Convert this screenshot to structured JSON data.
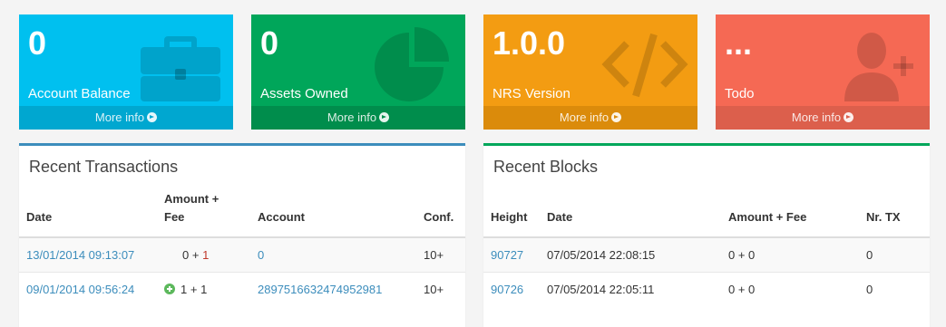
{
  "tiles": [
    {
      "value": "0",
      "label": "Account Balance",
      "footer": "More info",
      "icon": "briefcase-icon"
    },
    {
      "value": "0",
      "label": "Assets Owned",
      "footer": "More info",
      "icon": "pie-chart-icon"
    },
    {
      "value": "1.0.0",
      "label": "NRS Version",
      "footer": "More info",
      "icon": "code-icon"
    },
    {
      "value": "...",
      "label": "Todo",
      "footer": "More info",
      "icon": "user-plus-icon"
    }
  ],
  "transactions": {
    "title": "Recent Transactions",
    "columns": {
      "date": "Date",
      "amount_line1": "Amount +",
      "amount_line2": "Fee",
      "account": "Account",
      "conf": "Conf."
    },
    "rows": [
      {
        "date": "13/01/2014 09:13:07",
        "amount": "0",
        "plus": "+",
        "fee": "1",
        "account": "0",
        "conf": "10+",
        "incoming": false
      },
      {
        "date": "09/01/2014 09:56:24",
        "amount": "1",
        "plus": "+",
        "fee": "1",
        "account": "2897516632474952981",
        "conf": "10+",
        "incoming": true
      }
    ]
  },
  "blocks": {
    "title": "Recent Blocks",
    "columns": {
      "height": "Height",
      "date": "Date",
      "amount_fee": "Amount + Fee",
      "nr_tx": "Nr. TX"
    },
    "rows": [
      {
        "height": "90727",
        "date": "07/05/2014 22:08:15",
        "amount_fee": "0 + 0",
        "nr_tx": "0"
      },
      {
        "height": "90726",
        "date": "07/05/2014 22:05:11",
        "amount_fee": "0 + 0",
        "nr_tx": "0"
      }
    ]
  }
}
